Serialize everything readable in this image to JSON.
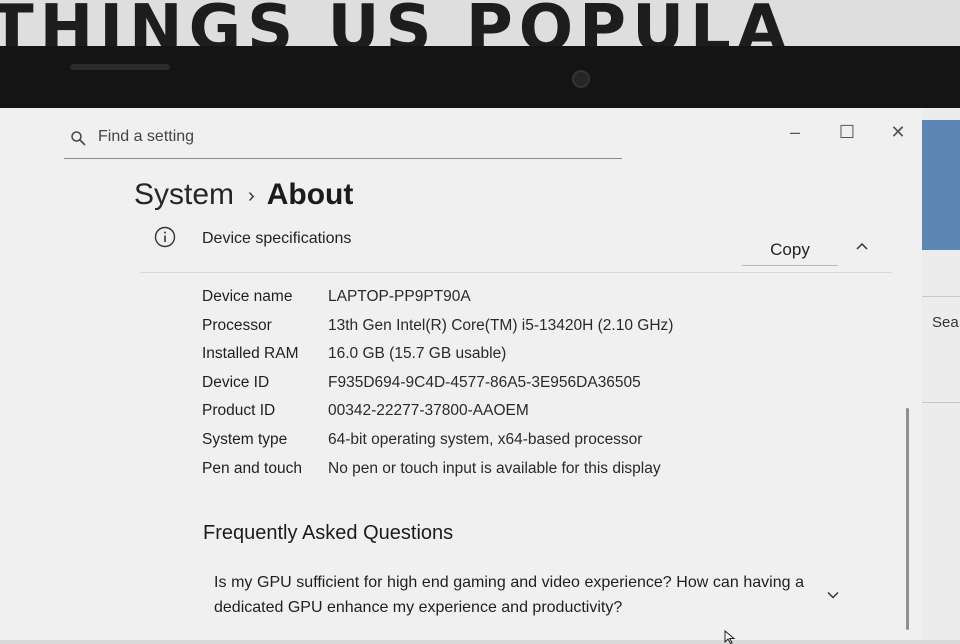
{
  "backdrop": {
    "text": "THINGS US POPULA"
  },
  "window": {
    "search": {
      "placeholder": "Find a setting",
      "value": ""
    },
    "controls": {
      "minimize": "–",
      "maximize": "☐",
      "close": "✕"
    },
    "breadcrumb": {
      "parent": "System",
      "separator": "›",
      "current": "About"
    }
  },
  "device_specs": {
    "title": "Device specifications",
    "copy_label": "Copy",
    "rows": [
      {
        "label": "Device name",
        "value": "LAPTOP-PP9PT90A"
      },
      {
        "label": "Processor",
        "value": "13th Gen Intel(R) Core(TM) i5-13420H (2.10 GHz)"
      },
      {
        "label": "Installed RAM",
        "value": "16.0 GB (15.7 GB usable)"
      },
      {
        "label": "Device ID",
        "value": "F935D694-9C4D-4577-86A5-3E956DA36505"
      },
      {
        "label": "Product ID",
        "value": "00342-22277-37800-AAOEM"
      },
      {
        "label": "System type",
        "value": "64-bit operating system, x64-based processor"
      },
      {
        "label": "Pen and touch",
        "value": "No pen or touch input is available for this display"
      }
    ]
  },
  "faq": {
    "title": "Frequently Asked Questions",
    "items": [
      {
        "question": "Is my GPU sufficient for high end gaming and video experience? How can having a dedicated GPU enhance my experience and productivity?"
      }
    ]
  },
  "right_app": {
    "search_text": "Sea"
  },
  "icons": {
    "search": "search-icon",
    "info": "info-icon",
    "collapse": "chevron-up-icon",
    "expand": "chevron-down-icon"
  }
}
